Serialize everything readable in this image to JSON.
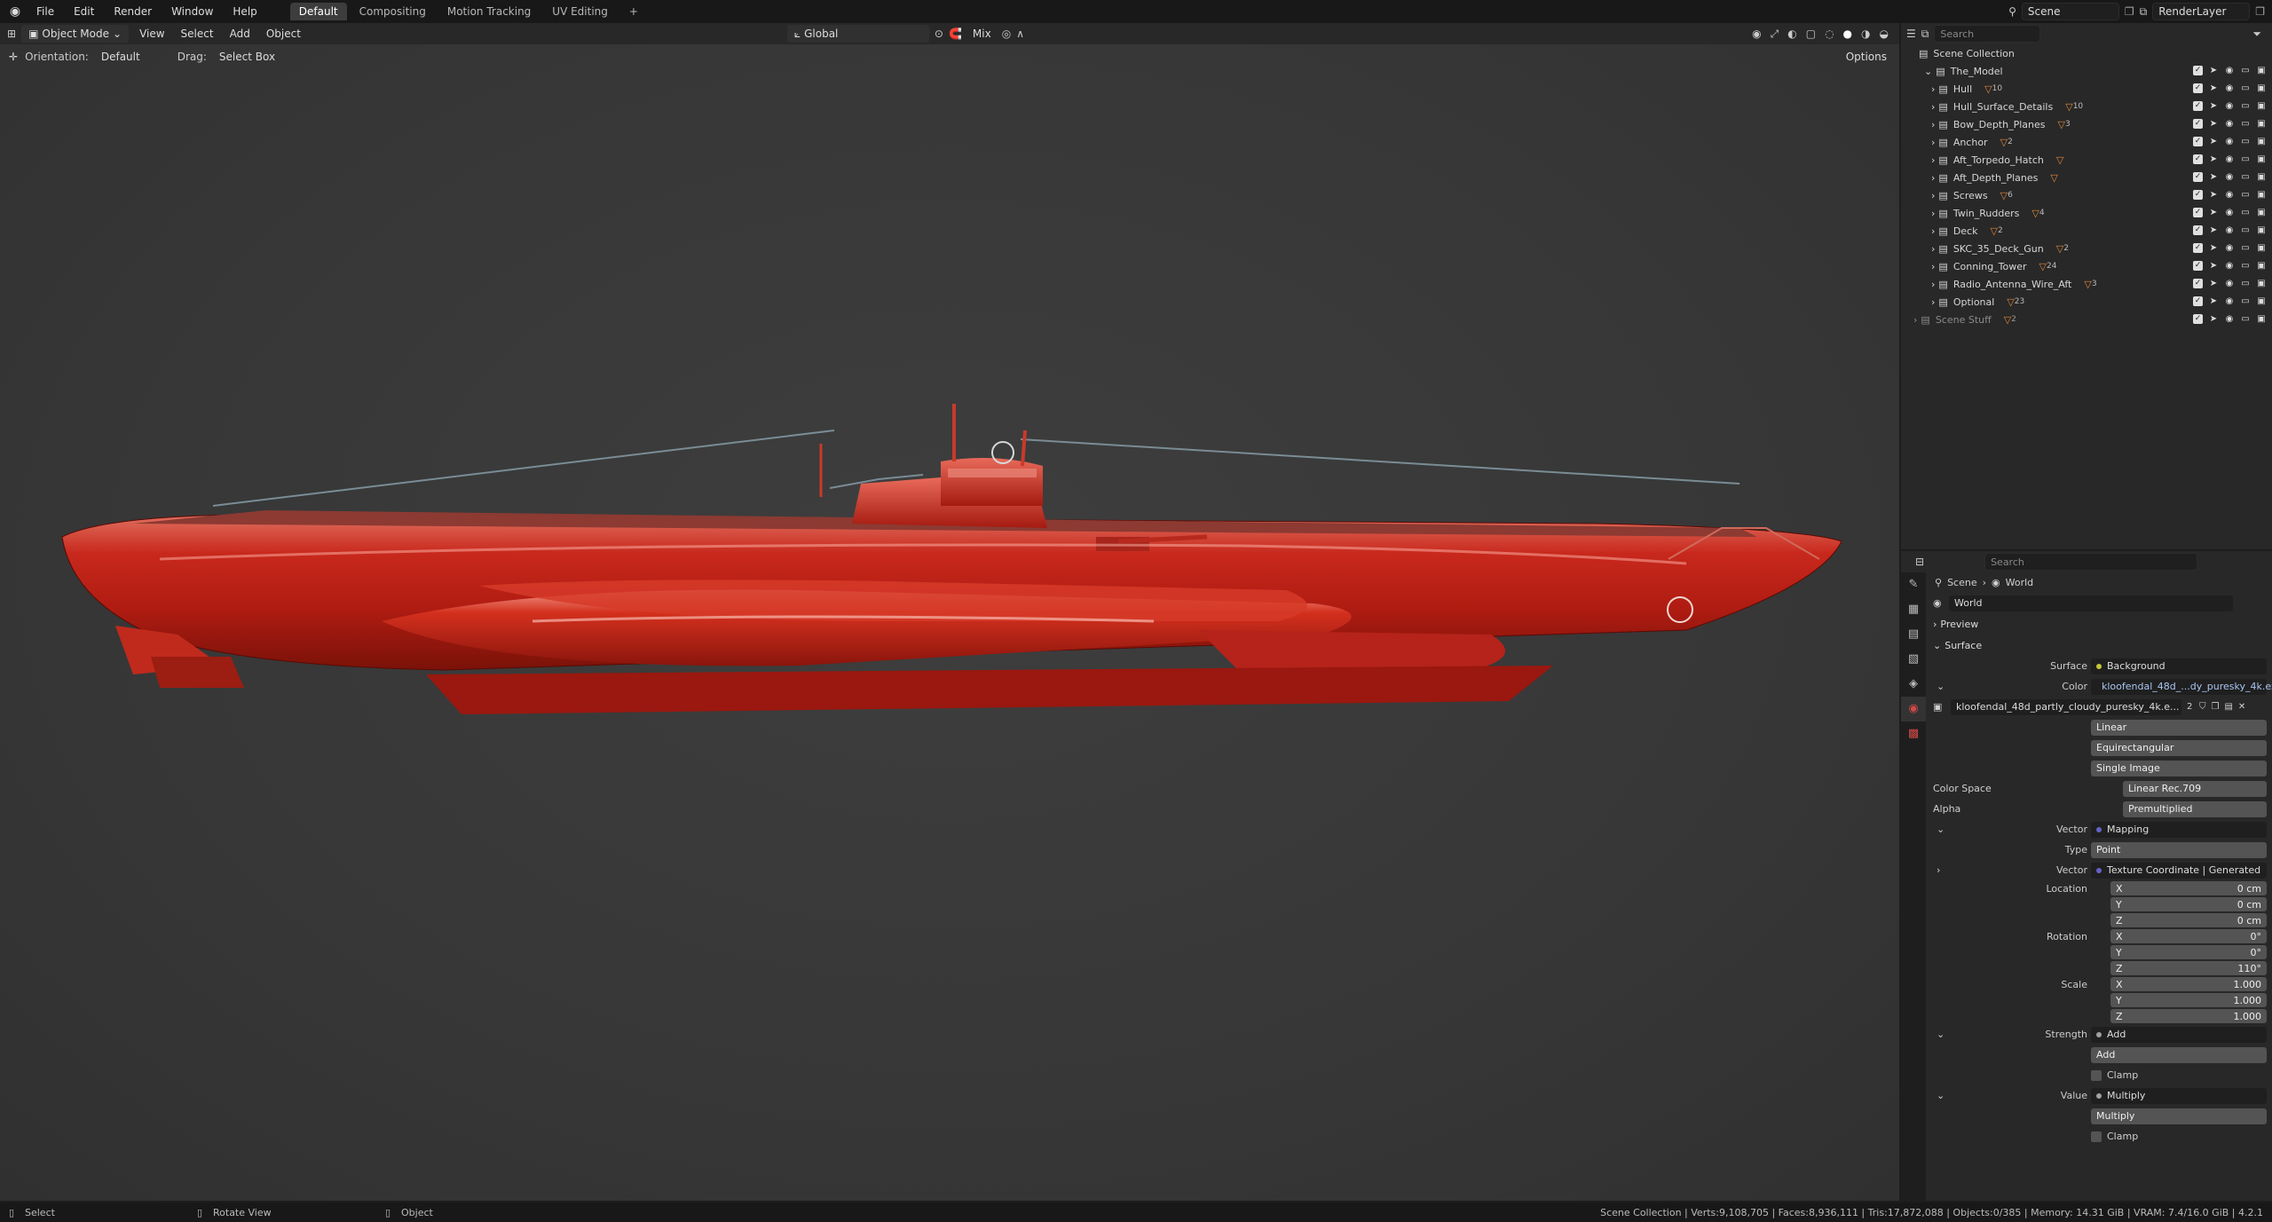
{
  "topbar": {
    "menus": [
      "File",
      "Edit",
      "Render",
      "Window",
      "Help"
    ],
    "workspaces": [
      "Default",
      "Compositing",
      "Motion Tracking",
      "UV Editing"
    ],
    "active_workspace": "Default",
    "add_workspace": "+",
    "scene": "Scene",
    "view_layer": "RenderLayer"
  },
  "viewport_header": {
    "mode": "Object Mode",
    "menus": [
      "View",
      "Select",
      "Add",
      "Object"
    ],
    "transform_orientation": "Global",
    "snap_mix": "Mix"
  },
  "tool_header": {
    "orientation_label": "Orientation:",
    "orientation_value": "Default",
    "drag_label": "Drag:",
    "drag_value": "Select Box",
    "options": "Options"
  },
  "outliner": {
    "search_placeholder": "Search",
    "root": "Scene Collection",
    "collection": "The_Model",
    "items": [
      {
        "name": "Hull",
        "badge": "10"
      },
      {
        "name": "Hull_Surface_Details",
        "badge": "10"
      },
      {
        "name": "Bow_Depth_Planes",
        "badge": "3"
      },
      {
        "name": "Anchor",
        "badge": "2"
      },
      {
        "name": "Aft_Torpedo_Hatch",
        "badge": ""
      },
      {
        "name": "Aft_Depth_Planes",
        "badge": ""
      },
      {
        "name": "Screws",
        "badge": "6"
      },
      {
        "name": "Twin_Rudders",
        "badge": "4"
      },
      {
        "name": "Deck",
        "badge": "2"
      },
      {
        "name": "SKC_35_Deck_Gun",
        "badge": "2"
      },
      {
        "name": "Conning_Tower",
        "badge": "24"
      },
      {
        "name": "Radio_Antenna_Wire_Aft",
        "badge": "3"
      },
      {
        "name": "Optional",
        "badge": "23"
      }
    ],
    "extra_collection": "Scene Stuff",
    "extra_badge": "2"
  },
  "properties": {
    "search_placeholder": "Search",
    "breadcrumb": [
      "Scene",
      "World"
    ],
    "world_name": "World",
    "sections": {
      "preview": "Preview",
      "surface": "Surface"
    },
    "surface": {
      "label": "Surface",
      "value": "Background"
    },
    "color": {
      "label": "Color",
      "value": "kloofendal_48d_...dy_puresky_4k.exr"
    },
    "image": {
      "name": "kloofendal_48d_partly_cloudy_puresky_4k.e...",
      "users": "2"
    },
    "interpolation": "Linear",
    "projection": "Equirectangular",
    "source": "Single Image",
    "color_space": {
      "label": "Color Space",
      "value": "Linear Rec.709"
    },
    "alpha": {
      "label": "Alpha",
      "value": "Premultiplied"
    },
    "vector": {
      "label": "Vector",
      "value": "Mapping"
    },
    "type": {
      "label": "Type",
      "value": "Point"
    },
    "vector2": {
      "label": "Vector",
      "value": "Texture Coordinate | Generated"
    },
    "location": {
      "label": "Location",
      "x": "0 cm",
      "y": "0 cm",
      "z": "0 cm"
    },
    "rotation": {
      "label": "Rotation",
      "x": "0°",
      "y": "0°",
      "z": "110°"
    },
    "scale": {
      "label": "Scale",
      "x": "1.000",
      "y": "1.000",
      "z": "1.000"
    },
    "axis": {
      "x": "X",
      "y": "Y",
      "z": "Z"
    },
    "strength": {
      "label": "Strength",
      "value": "Add",
      "op": "Add",
      "clamp": "Clamp"
    },
    "value": {
      "label": "Value",
      "value": "Multiply",
      "op": "Multiply",
      "clamp": "Clamp"
    }
  },
  "statusbar": {
    "select": "Select",
    "rotate": "Rotate View",
    "object": "Object",
    "stats": "Scene Collection | Verts:9,108,705 | Faces:8,936,111 | Tris:17,872,088 | Objects:0/385 | Memory: 14.31 GiB | VRAM: 7.4/16.0 GiB | 4.2.1"
  },
  "colors": {
    "hull_red": "#c8281c",
    "background": "#3a3a3a",
    "accent": "#4772b3"
  }
}
